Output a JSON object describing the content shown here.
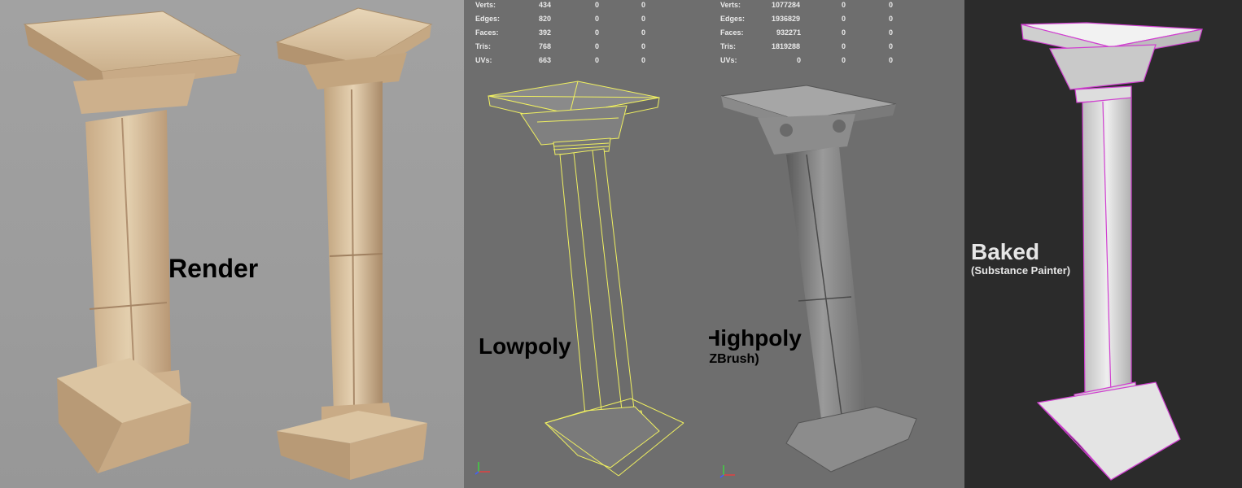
{
  "render": {
    "label": "Render"
  },
  "lowpoly": {
    "label": "Lowpoly",
    "stats": [
      {
        "name": "Verts:",
        "values": [
          "434",
          "0",
          "0"
        ]
      },
      {
        "name": "Edges:",
        "values": [
          "820",
          "0",
          "0"
        ]
      },
      {
        "name": "Faces:",
        "values": [
          "392",
          "0",
          "0"
        ]
      },
      {
        "name": "Tris:",
        "values": [
          "768",
          "0",
          "0"
        ]
      },
      {
        "name": "UVs:",
        "values": [
          "663",
          "0",
          "0"
        ]
      }
    ],
    "wire_color": "#f0f060"
  },
  "highpoly": {
    "label": "Highpoly",
    "sublabel": "(ZBrush)",
    "stats": [
      {
        "name": "Verts:",
        "values": [
          "1077284",
          "0",
          "0"
        ]
      },
      {
        "name": "Edges:",
        "values": [
          "1936829",
          "0",
          "0"
        ]
      },
      {
        "name": "Faces:",
        "values": [
          "932271",
          "0",
          "0"
        ]
      },
      {
        "name": "Tris:",
        "values": [
          "1819288",
          "0",
          "0"
        ]
      },
      {
        "name": "UVs:",
        "values": [
          "0",
          "0",
          "0"
        ]
      }
    ]
  },
  "baked": {
    "label": "Baked",
    "sublabel": "(Substance Painter)",
    "edge_color": "#d040d0"
  },
  "axis_gizmo": {
    "x": "x",
    "y": "y",
    "z": "z"
  }
}
